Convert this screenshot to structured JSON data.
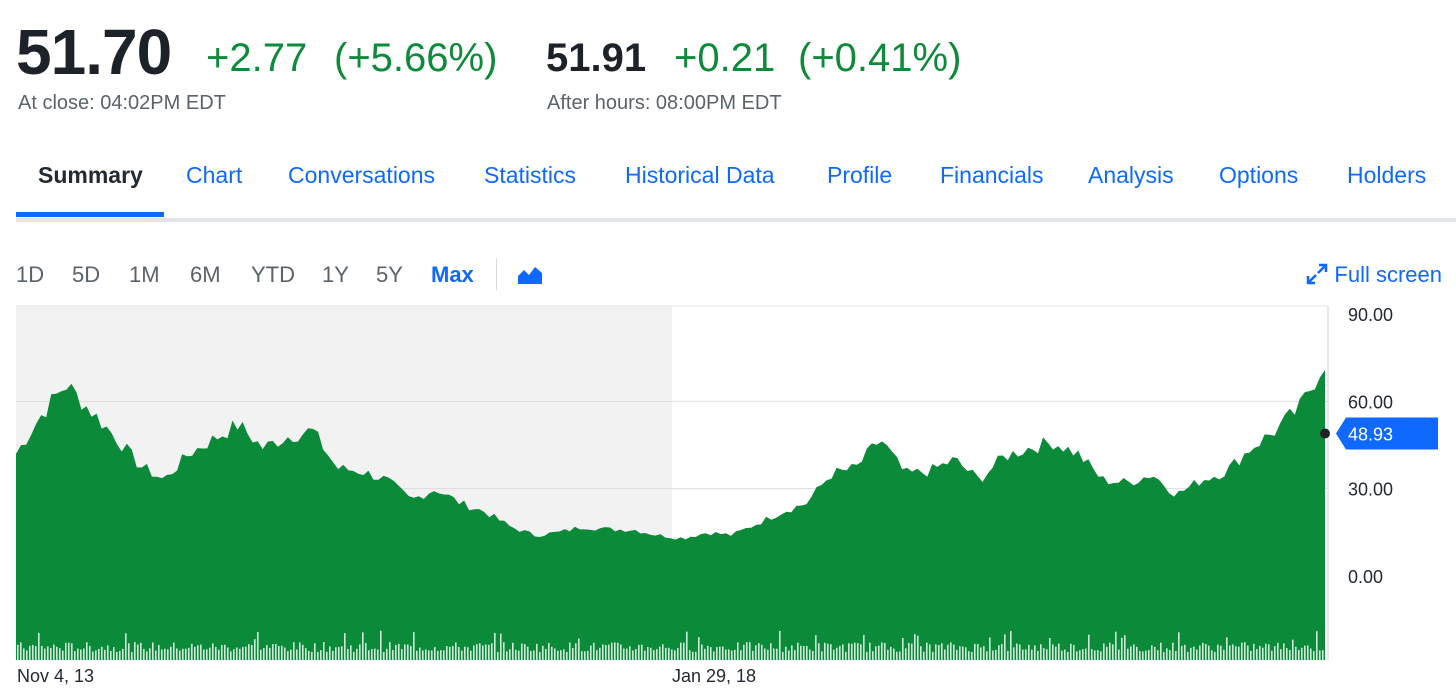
{
  "quote": {
    "price": "51.70",
    "change": "+2.77",
    "change_pct": "(+5.66%)",
    "close_label": "At close: 04:02PM EDT",
    "after_hours_price": "51.91",
    "after_hours_change": "+0.21",
    "after_hours_change_pct": "(+0.41%)",
    "after_hours_label": "After hours: 08:00PM EDT",
    "positive_color": "#0d8a3a"
  },
  "tabs": [
    {
      "label": "Summary",
      "active": true
    },
    {
      "label": "Chart"
    },
    {
      "label": "Conversations"
    },
    {
      "label": "Statistics"
    },
    {
      "label": "Historical Data"
    },
    {
      "label": "Profile"
    },
    {
      "label": "Financials"
    },
    {
      "label": "Analysis"
    },
    {
      "label": "Options"
    },
    {
      "label": "Holders"
    }
  ],
  "ranges": [
    "1D",
    "5D",
    "1M",
    "6M",
    "YTD",
    "1Y",
    "5Y",
    "Max"
  ],
  "active_range": "Max",
  "chart_type_icon": "area-chart-icon",
  "fullscreen": {
    "label": "Full screen",
    "icon": "expand-arrows-icon"
  },
  "colors": {
    "accent": "#0f69ff",
    "area_fill": "#0b8a3a",
    "shade": "#f2f2f2"
  },
  "chart_data": {
    "type": "area",
    "x_labels": [
      "Nov 4, 13",
      "Jan 29, 18"
    ],
    "y_ticks": [
      "90.00",
      "60.00",
      "30.00",
      "0.00"
    ],
    "ylim": [
      0,
      90
    ],
    "current_value_label": "48.93",
    "current_value": 48.93,
    "grid": true,
    "series": [
      {
        "x": [
          "2013-11",
          "2014-01",
          "2014-03",
          "2014-05",
          "2014-07",
          "2014-09",
          "2014-11",
          "2015-01",
          "2015-03",
          "2015-05",
          "2015-07",
          "2015-09",
          "2015-11",
          "2016-01",
          "2016-03",
          "2016-05",
          "2016-07",
          "2016-09",
          "2016-11",
          "2017-01",
          "2017-03",
          "2017-05",
          "2017-07",
          "2017-09",
          "2017-11",
          "2018-01",
          "2018-03",
          "2018-05",
          "2018-07",
          "2018-09",
          "2018-11",
          "2019-01",
          "2019-03",
          "2019-05",
          "2019-07",
          "2019-09",
          "2019-11",
          "2020-01",
          "2020-03",
          "2020-05",
          "2020-07",
          "2020-09",
          "2020-11",
          "2021-01",
          "2021-03",
          "2021-05",
          "2021-07",
          "2021-09",
          "2021-11",
          "2022-01",
          "2022-03",
          "2022-05",
          "2022-07",
          "2022-09"
        ],
        "values": [
          42,
          55,
          66,
          57,
          48,
          38,
          33,
          42,
          47,
          52,
          44,
          48,
          50,
          37,
          36,
          33,
          26,
          30,
          25,
          22,
          17,
          14,
          15,
          17,
          16,
          16,
          14,
          13,
          15,
          14,
          18,
          22,
          25,
          35,
          37,
          47,
          35,
          36,
          40,
          33,
          41,
          44,
          46,
          42,
          33,
          32,
          35,
          28,
          33,
          36,
          44,
          50,
          58,
          74
        ]
      }
    ]
  },
  "volume_note": "volume bars along chart bottom"
}
